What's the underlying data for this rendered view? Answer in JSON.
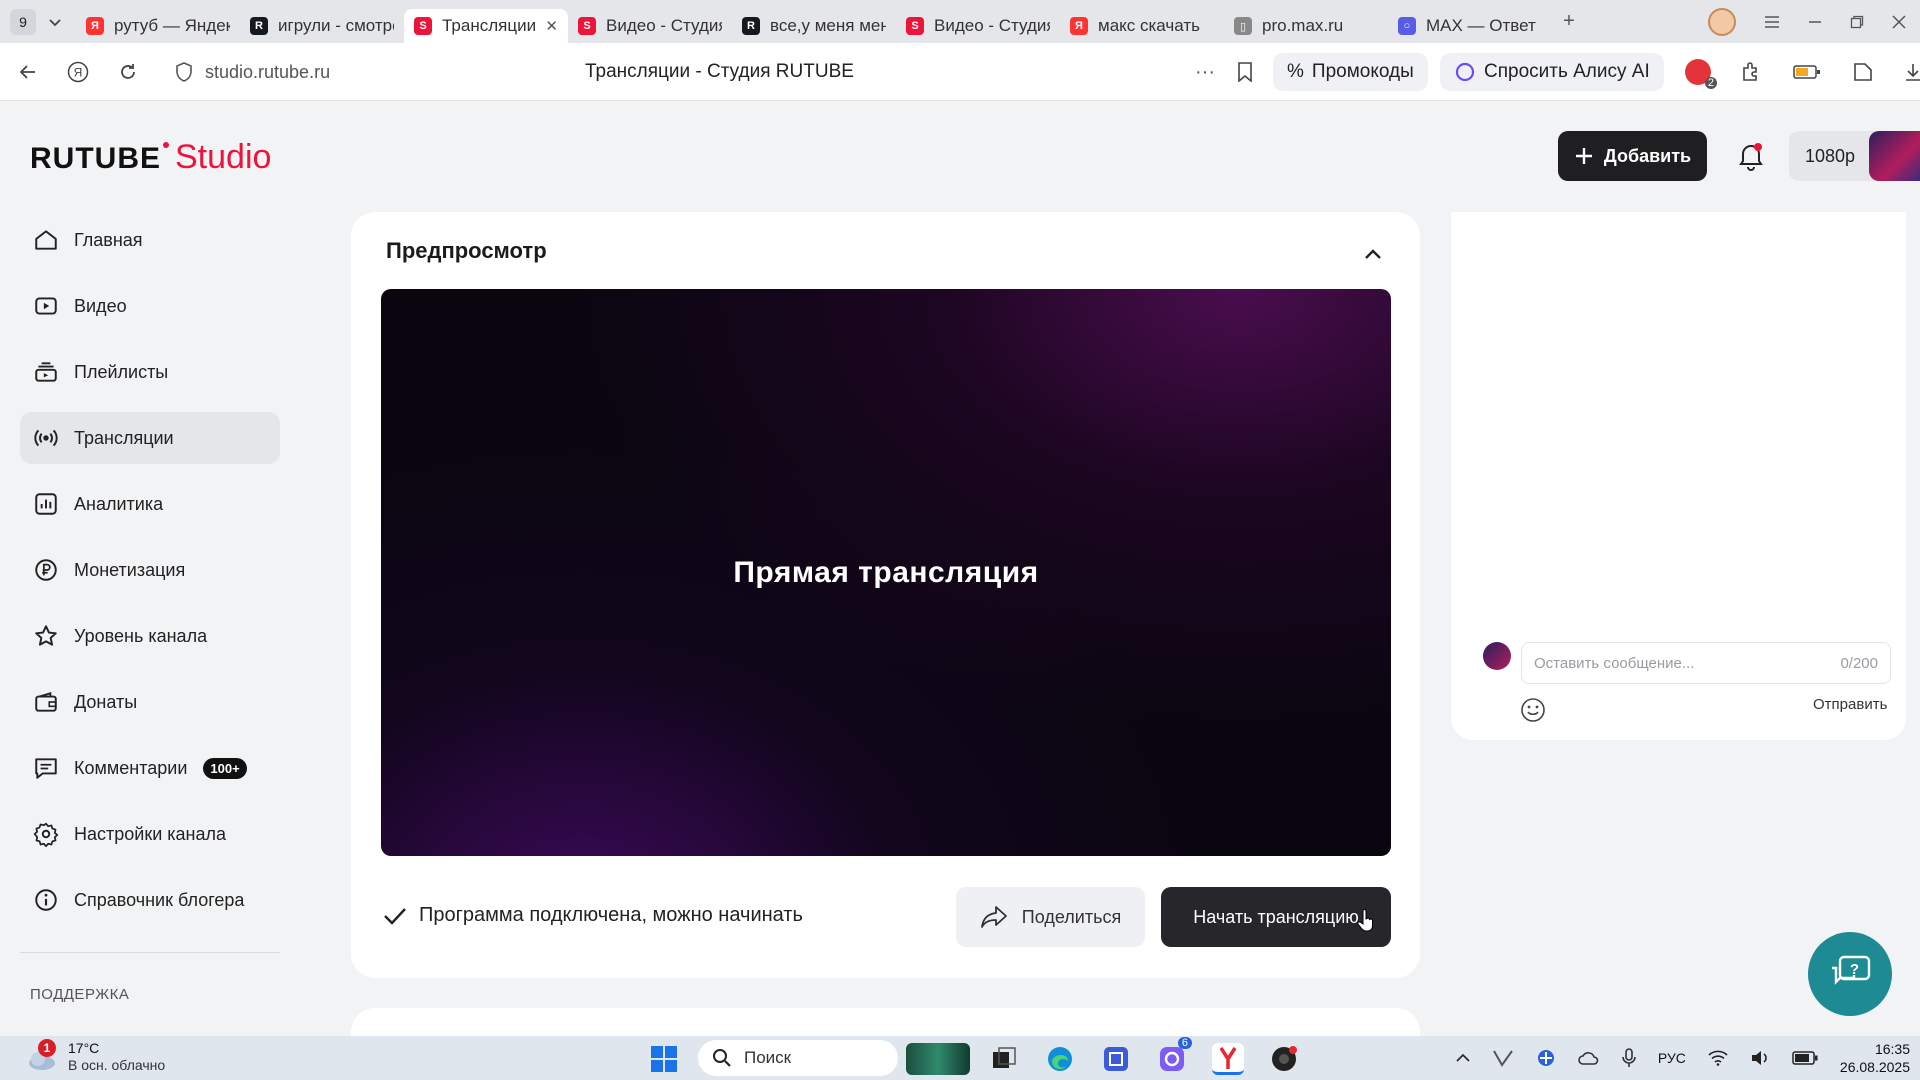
{
  "browser": {
    "tab_count": "9",
    "tabs": [
      {
        "title": "рутуб — Яндекс",
        "fav": "Я",
        "color": "#f33"
      },
      {
        "title": "игрули - смотреть",
        "fav": "R",
        "color": "#14191f"
      },
      {
        "title": "Трансляции",
        "fav": "S",
        "color": "#ed143b",
        "active": true
      },
      {
        "title": "Видео - Студия",
        "fav": "S",
        "color": "#ed143b"
      },
      {
        "title": "все,у меня меня",
        "fav": "R",
        "color": "#14191f"
      },
      {
        "title": "Видео - Студия",
        "fav": "S",
        "color": "#ed143b"
      },
      {
        "title": "макс скачать",
        "fav": "Я",
        "color": "#f33"
      },
      {
        "title": "pro.max.ru",
        "fav": "▯",
        "color": "#888"
      },
      {
        "title": "MAX — Ответ",
        "fav": "○",
        "color": "#5b5ce6"
      }
    ],
    "url": "studio.rutube.ru",
    "page_title": "Трансляции - Студия RUTUBE",
    "promo_label": "Промокоды",
    "alice_label": "Спросить Алису AI",
    "ext_badge": "2"
  },
  "header": {
    "logo_word": "RUTUBE",
    "logo_studio": "Studio",
    "add_label": "Добавить",
    "quality": "1080p"
  },
  "sidebar": {
    "items": [
      {
        "label": "Главная",
        "icon": "home-icon"
      },
      {
        "label": "Видео",
        "icon": "video-icon"
      },
      {
        "label": "Плейлисты",
        "icon": "playlist-icon"
      },
      {
        "label": "Трансляции",
        "icon": "broadcast-icon",
        "active": true
      },
      {
        "label": "Аналитика",
        "icon": "analytics-icon"
      },
      {
        "label": "Монетизация",
        "icon": "ruble-icon"
      },
      {
        "label": "Уровень канала",
        "icon": "star-icon"
      },
      {
        "label": "Донаты",
        "icon": "wallet-icon"
      },
      {
        "label": "Комментарии",
        "icon": "comment-icon",
        "badge": "100+"
      },
      {
        "label": "Настройки канала",
        "icon": "gear-icon"
      },
      {
        "label": "Справочник блогера",
        "icon": "info-icon"
      }
    ],
    "support_heading": "ПОДДЕРЖКА"
  },
  "preview": {
    "title": "Предпросмотр",
    "stream_label": "Прямая трансляция",
    "status_text": "Программа подключена, можно начинать",
    "share_label": "Поделиться",
    "start_label": "Начать трансляцию"
  },
  "chat": {
    "placeholder": "Оставить сообщение...",
    "counter": "0/200",
    "send_label": "Отправить"
  },
  "taskbar": {
    "weather_badge": "1",
    "temperature": "17°C",
    "weather_desc": "В осн. облачно",
    "search_label": "Поиск",
    "lang": "РУС",
    "time": "16:35",
    "date": "26.08.2025",
    "notif_count": "6"
  },
  "colors": {
    "brand": "#ed143b",
    "dark_button": "#26262b",
    "help_button": "#1d8a94"
  }
}
